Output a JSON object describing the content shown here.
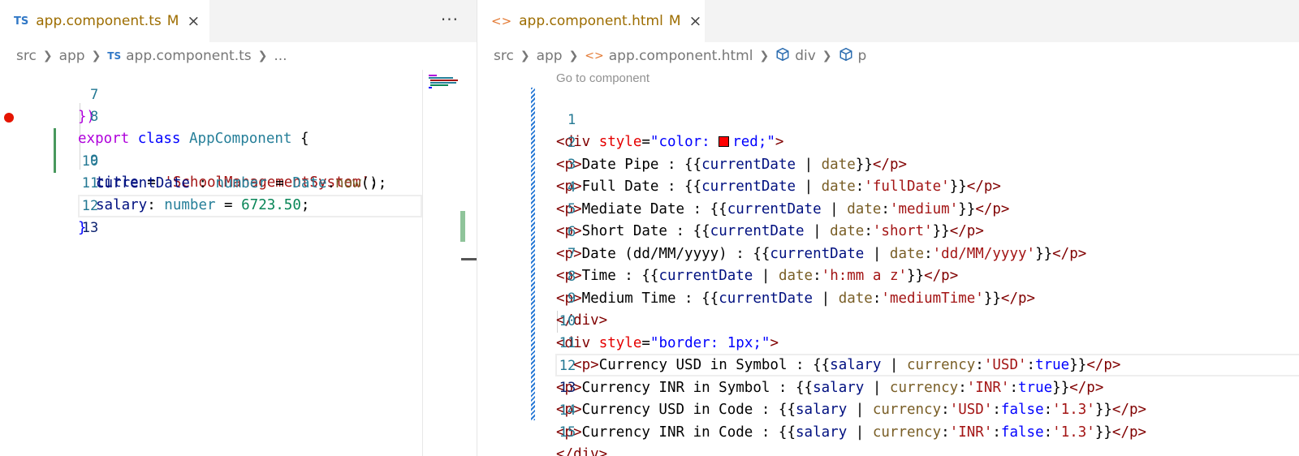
{
  "left_editor": {
    "tab": {
      "icon": "TS",
      "filename": "app.component.ts",
      "modified": "M",
      "close": "×"
    },
    "more_actions": "···",
    "breadcrumb": {
      "folder1": "src",
      "folder2": "app",
      "file_icon": "TS",
      "file": "app.component.ts",
      "ellipsis": "..."
    },
    "line_numbers": [
      "7",
      "8",
      "9",
      "10",
      "11",
      "12",
      "13"
    ],
    "lines": {
      "l7": {
        "brace": "})"
      },
      "l8": {
        "export": "export",
        "class": "class",
        "name": "AppComponent",
        "open": "{"
      },
      "l9": {
        "prop": "title",
        "eq": " = ",
        "str": "'SchoolManagementSystem'",
        "semi": ";"
      },
      "l10": {
        "prop": "currentDate",
        "colon": " : ",
        "type": "number",
        "eq": " = ",
        "cls": "Date",
        "dot": ".",
        "fn": "now",
        "rest": "();"
      },
      "l11": {
        "prop": "salary",
        "colon": ": ",
        "type": "number",
        "eq": " = ",
        "num": "6723.50",
        "semi": ";"
      },
      "l12": {
        "close": "}"
      }
    },
    "breakpoint_line": "9"
  },
  "right_editor": {
    "tab": {
      "icon": "<>",
      "filename": "app.component.html",
      "modified": "M",
      "close": "×"
    },
    "breadcrumb": {
      "folder1": "src",
      "folder2": "app",
      "file_icon": "<>",
      "file": "app.component.html",
      "node1_icon": "cube-icon",
      "node1": "div",
      "node2_icon": "cube-icon",
      "node2": "p"
    },
    "code_lens": "Go to component",
    "line_numbers": [
      "1",
      "2",
      "3",
      "4",
      "5",
      "6",
      "7",
      "8",
      "9",
      "10",
      "11",
      "12",
      "13",
      "14",
      "15"
    ],
    "lines": {
      "l1": {
        "open": "<div ",
        "attr": "style",
        "eq": "=",
        "q1": "\"color: ",
        "color": "red",
        "q2": ";\"",
        "close": ">"
      },
      "l2": {
        "tag": "<p>",
        "text": "Date Pipe : {{",
        "var": "currentDate",
        "bar": " | ",
        "pipe": "date",
        "end": "}}",
        "ctag": "</p>"
      },
      "l3": {
        "tag": "<p>",
        "text": "Full Date : {{",
        "var": "currentDate",
        "bar": " | ",
        "pipe": "date",
        "colon": ":",
        "arg": "'fullDate'",
        "end": "}}",
        "ctag": "</p>"
      },
      "l4": {
        "tag": "<p>",
        "text": "Mediate Date : {{",
        "var": "currentDate",
        "bar": " | ",
        "pipe": "date",
        "colon": ":",
        "arg": "'medium'",
        "end": "}}",
        "ctag": "</p>"
      },
      "l5": {
        "tag": "<p>",
        "text": "Short Date : {{",
        "var": "currentDate",
        "bar": " | ",
        "pipe": "date",
        "colon": ":",
        "arg": "'short'",
        "end": "}}",
        "ctag": "</p>"
      },
      "l6": {
        "tag": "<p>",
        "text": "Date (dd/MM/yyyy) : {{",
        "var": "currentDate",
        "bar": " | ",
        "pipe": "date",
        "colon": ":",
        "arg": "'dd/MM/yyyy'",
        "end": "}}",
        "ctag": "</p>"
      },
      "l7": {
        "tag": "<p>",
        "text": "Time : {{",
        "var": "currentDate",
        "bar": " | ",
        "pipe": "date",
        "colon": ":",
        "arg": "'h:mm a z'",
        "end": "}}",
        "ctag": "</p>"
      },
      "l8": {
        "tag": "<p>",
        "text": "Medium Time : {{",
        "var": "currentDate",
        "bar": " | ",
        "pipe": "date",
        "colon": ":",
        "arg": "'mediumTime'",
        "end": "}}",
        "ctag": "</p>"
      },
      "l9": {
        "ctag": "</div>"
      },
      "l10": {
        "open": "<div ",
        "attr": "style",
        "eq": "=",
        "val": "\"border: 1px;\"",
        "close": ">"
      },
      "l11": {
        "indent": "  ",
        "tag": "<p>",
        "text": "Currency USD in Symbol : {{",
        "var": "salary",
        "bar": " | ",
        "pipe": "currency",
        "c1": ":",
        "arg1": "'USD'",
        "c2": ":",
        "arg2": "true",
        "end": "}}",
        "ctag": "</p>"
      },
      "l12": {
        "tag": "<p>",
        "text": "Currency INR in Symbol : {{",
        "var": "salary",
        "bar": " | ",
        "pipe": "currency",
        "c1": ":",
        "arg1": "'INR'",
        "c2": ":",
        "arg2": "true",
        "end": "}}",
        "ctag": "</p>"
      },
      "l13": {
        "tag": "<p>",
        "text": "Currency USD in Code : {{",
        "var": "salary",
        "bar": " | ",
        "pipe": "currency",
        "c1": ":",
        "arg1": "'USD'",
        "c2": ":",
        "arg2": "false",
        "c3": ":",
        "arg3": "'1.3'",
        "end": "}}",
        "ctag": "</p>"
      },
      "l14": {
        "tag": "<p>",
        "text": "Currency INR in Code : {{",
        "var": "salary",
        "bar": " | ",
        "pipe": "currency",
        "c1": ":",
        "arg1": "'INR'",
        "c2": ":",
        "arg2": "false",
        "c3": ":",
        "arg3": "'1.3'",
        "end": "}}",
        "ctag": "</p>"
      },
      "l15": {
        "ctag": "</div>"
      }
    },
    "active_line": "13",
    "swatch_color": "#ff0000"
  },
  "colors": {
    "keyword": "#0000ff",
    "control_keyword": "#af00db",
    "class_name": "#267f99",
    "string": "#a31515",
    "number": "#098658",
    "function": "#795e26",
    "variable": "#001080",
    "html_tag": "#800000",
    "html_attr": "#e50000",
    "line_number": "#237893",
    "modified_gutter": "#48985d",
    "breakpoint": "#e51400",
    "tab_modified": "#9d6d00"
  }
}
